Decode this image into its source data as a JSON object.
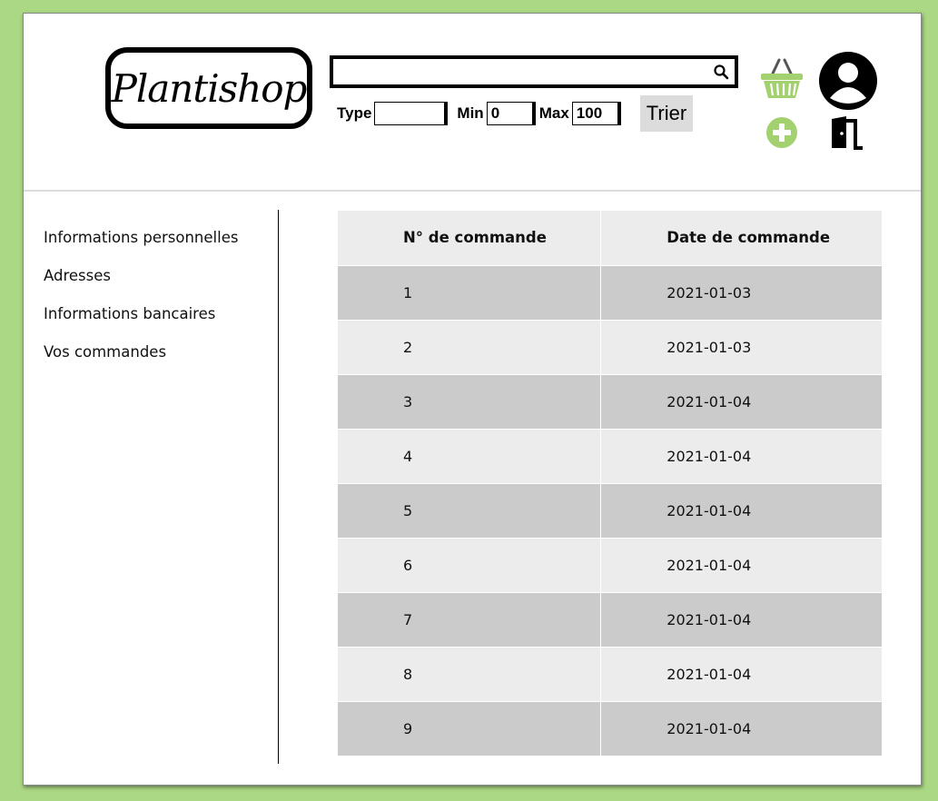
{
  "header": {
    "logo_text": "Plantishop",
    "search": {
      "value": "",
      "placeholder": ""
    },
    "filters": {
      "type_label": "Type",
      "type_value": "",
      "min_label": "Min",
      "min_value": "0",
      "max_label": "Max",
      "max_value": "100",
      "sort_label": "Trier"
    },
    "icons": {
      "basket": "basket-icon",
      "user": "user-icon",
      "add": "add-icon",
      "logout": "logout-icon"
    },
    "accent_color": "#a3d16f"
  },
  "sidebar": {
    "items": [
      {
        "label": "Informations personnelles"
      },
      {
        "label": "Adresses"
      },
      {
        "label": "Informations bancaires"
      },
      {
        "label": "Vos commandes"
      }
    ]
  },
  "orders": {
    "columns": [
      "N° de commande",
      "Date de commande"
    ],
    "rows": [
      {
        "number": "1",
        "date": "2021-01-03"
      },
      {
        "number": "2",
        "date": "2021-01-03"
      },
      {
        "number": "3",
        "date": "2021-01-04"
      },
      {
        "number": "4",
        "date": "2021-01-04"
      },
      {
        "number": "5",
        "date": "2021-01-04"
      },
      {
        "number": "6",
        "date": "2021-01-04"
      },
      {
        "number": "7",
        "date": "2021-01-04"
      },
      {
        "number": "8",
        "date": "2021-01-04"
      },
      {
        "number": "9",
        "date": "2021-01-04"
      }
    ]
  },
  "colors": {
    "background": "#abd884",
    "row_dark": "#cbcbcb",
    "row_light": "#ececec"
  }
}
